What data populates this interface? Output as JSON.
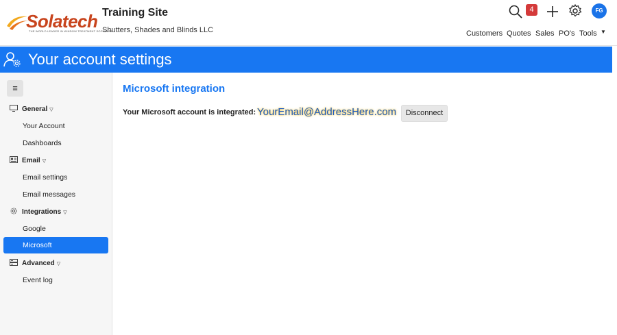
{
  "header": {
    "logo_text": "Solatech",
    "logo_tagline": "THE WORLD LEADER IN WINDOW TREATMENT SOFTWARE",
    "site_title": "Training Site",
    "company": "Shutters, Shades and Blinds LLC",
    "notification_count": "4",
    "avatar_initials": "FG",
    "nav": [
      "Customers",
      "Quotes",
      "Sales",
      "PO's",
      "Tools"
    ],
    "tools_caret": "▼"
  },
  "banner": {
    "title": "Your account settings"
  },
  "sidebar": {
    "toggle_glyph": "≡",
    "sections": [
      {
        "label": "General",
        "icon": "monitor-icon",
        "items": [
          "Your Account",
          "Dashboards"
        ]
      },
      {
        "label": "Email",
        "icon": "newspaper-icon",
        "items": [
          "Email settings",
          "Email messages"
        ]
      },
      {
        "label": "Integrations",
        "icon": "gear-icon",
        "items": [
          "Google",
          "Microsoft"
        ]
      },
      {
        "label": "Advanced",
        "icon": "server-icon",
        "items": [
          "Event log"
        ]
      }
    ],
    "active_item": "Microsoft",
    "caret": "▽"
  },
  "main": {
    "title": "Microsoft integration",
    "integration_label": "Your Microsoft account is integrated:",
    "email": "YourEmail@AddressHere.com",
    "disconnect_label": "Disconnect"
  },
  "colors": {
    "accent": "#1877f2",
    "badge": "#d43a3a",
    "logo": "#c8441d"
  }
}
